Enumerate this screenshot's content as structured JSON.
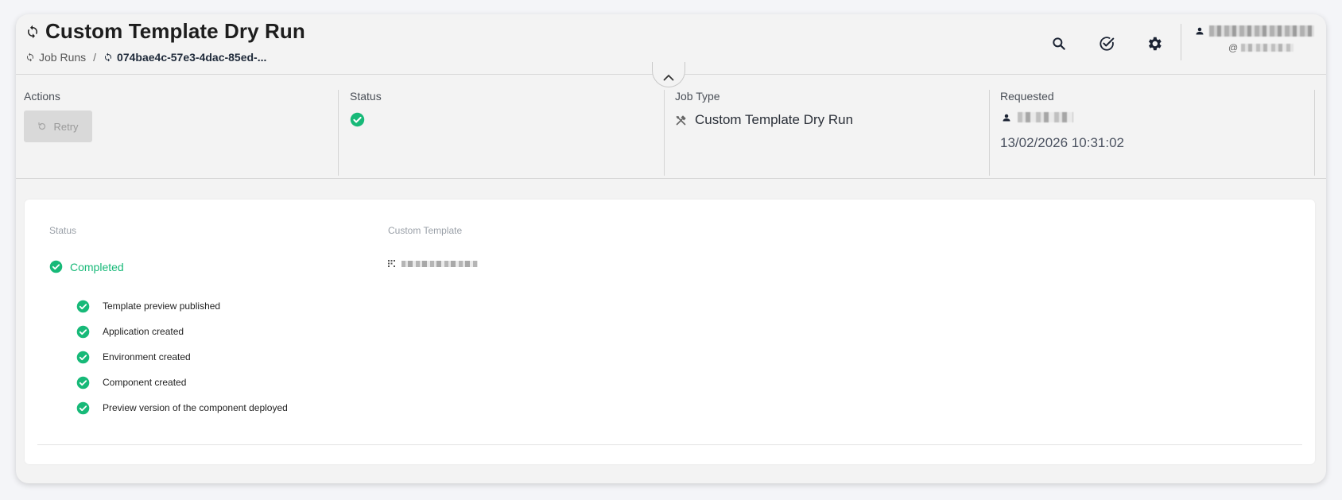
{
  "header": {
    "title": "Custom Template Dry Run",
    "breadcrumb": {
      "parent": "Job Runs",
      "separator": "/",
      "current": "074bae4c-57e3-4dac-85ed-..."
    },
    "icons": [
      "search-icon",
      "check-circle-icon",
      "gear-icon"
    ],
    "user": {
      "handle_prefix": "@"
    }
  },
  "summary": {
    "actions_label": "Actions",
    "retry_label": "Retry",
    "status_label": "Status",
    "job_type_label": "Job Type",
    "job_type_value": "Custom Template Dry Run",
    "requested_label": "Requested",
    "requested_date": "13/02/2026 10:31:02"
  },
  "details": {
    "status_label": "Status",
    "status_value": "Completed",
    "custom_template_label": "Custom Template",
    "steps": [
      "Template preview published",
      "Application created",
      "Environment created",
      "Component created",
      "Preview version of the component deployed"
    ]
  },
  "colors": {
    "success": "#17b978",
    "text": "#1f2733"
  }
}
